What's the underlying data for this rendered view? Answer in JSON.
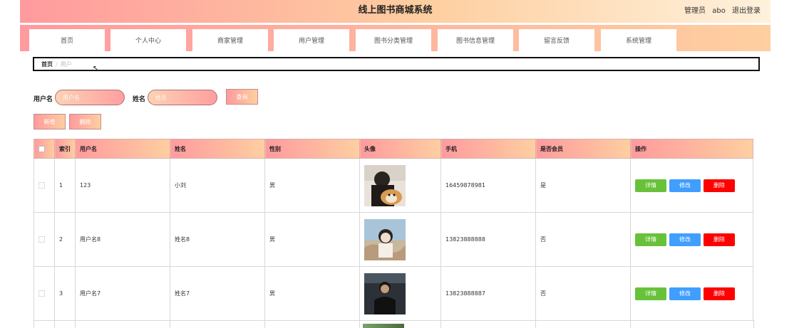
{
  "header": {
    "title": "线上图书商城系统",
    "role": "管理员",
    "username": "abo",
    "logout": "退出登录",
    "gradient": [
      "#ff9a9e",
      "#fecfa0"
    ]
  },
  "nav": {
    "items": [
      {
        "label": "首页"
      },
      {
        "label": "个人中心"
      },
      {
        "label": "商家管理"
      },
      {
        "label": "用户管理"
      },
      {
        "label": "图书分类管理"
      },
      {
        "label": "图书信息管理"
      },
      {
        "label": "留言反馈"
      },
      {
        "label": "系统管理"
      }
    ]
  },
  "breadcrumb": {
    "home": "首页",
    "separator": "/",
    "current": "用户"
  },
  "search": {
    "username_label": "用户名",
    "username_placeholder": "用户名",
    "name_label": "姓名",
    "name_placeholder": "姓名",
    "query_button": "查询"
  },
  "actions": {
    "add": "新增",
    "delete": "删除"
  },
  "table": {
    "headers": [
      "索引",
      "用户名",
      "姓名",
      "性别",
      "头像",
      "手机",
      "是否会员",
      "操作"
    ],
    "rows": [
      {
        "index": "1",
        "username": "123",
        "name": "小刘",
        "gender": "男",
        "phone": "16459878981",
        "member": "是"
      },
      {
        "index": "2",
        "username": "用户名8",
        "name": "姓名8",
        "gender": "男",
        "phone": "13823888888",
        "member": "否"
      },
      {
        "index": "3",
        "username": "用户名7",
        "name": "姓名7",
        "gender": "男",
        "phone": "13823888887",
        "member": "否"
      }
    ],
    "row_actions": {
      "detail": "详情",
      "edit": "修改",
      "delete": "删除"
    },
    "action_colors": {
      "detail": "#67c23a",
      "edit": "#409eff",
      "delete": "#ff0000"
    }
  }
}
